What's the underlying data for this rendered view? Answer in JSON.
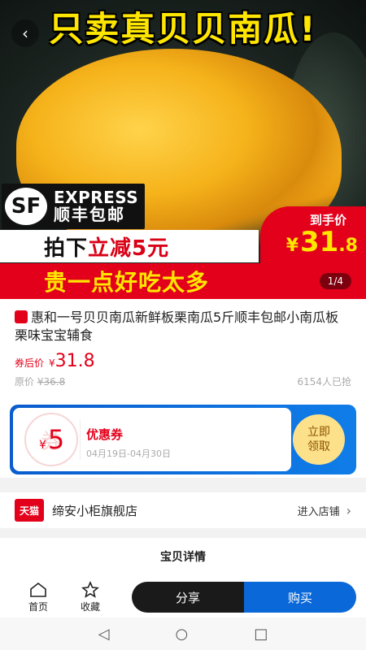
{
  "hero": {
    "headline": "只卖真贝贝南瓜!",
    "express_en": "EXPRESS",
    "express_cn": "顺丰包邮",
    "sf_logo": "SF",
    "price_label": "到手价",
    "price_currency": "¥",
    "price_big": "31",
    "price_small": ".8",
    "band1_prefix": "拍下",
    "band1_highlight": "立减5元",
    "band2_text": "贵一点好吃太多",
    "pager": "1/4"
  },
  "product": {
    "title": "惠和一号贝贝南瓜新鲜板栗南瓜5斤顺丰包邮小南瓜板栗味宝宝辅食",
    "after_label": "券后价",
    "after_currency": "¥",
    "after_price": "31.8",
    "original_label": "原价",
    "original_price": "¥36.8",
    "sold": "6154人已抢"
  },
  "coupon": {
    "currency": "¥",
    "amount": "5",
    "name": "优惠券",
    "date": "04月19日-04月30日",
    "claim_line1": "立即",
    "claim_line2": "领取",
    "stamp": "券"
  },
  "store": {
    "badge": "天猫",
    "name": "缔安小柜旗舰店",
    "link": "进入店铺"
  },
  "details": {
    "title": "宝贝详情"
  },
  "bottombar": {
    "home": "首页",
    "favorite": "收藏",
    "share": "分享",
    "buy": "购买"
  },
  "colors": {
    "brand_red": "#e3001b",
    "brand_blue": "#0a68d8",
    "accent_yellow": "#ffe600"
  }
}
